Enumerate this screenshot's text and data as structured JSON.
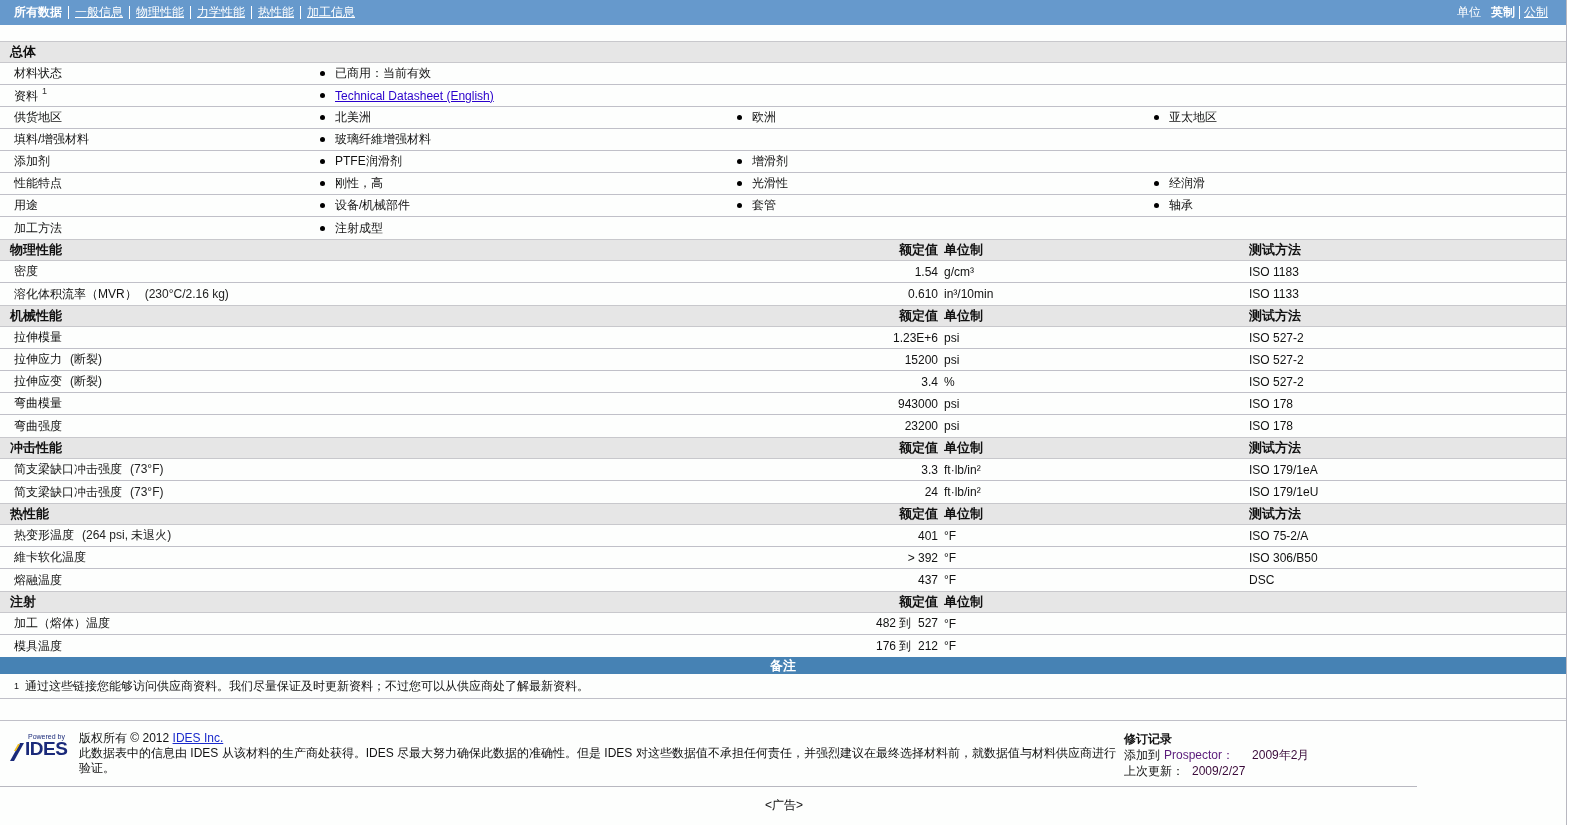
{
  "nav": {
    "tabs": [
      {
        "label": "所有数据",
        "selected": true
      },
      {
        "label": "一般信息",
        "selected": false
      },
      {
        "label": "物理性能",
        "selected": false
      },
      {
        "label": "力学性能",
        "selected": false
      },
      {
        "label": "热性能",
        "selected": false
      },
      {
        "label": "加工信息",
        "selected": false
      }
    ],
    "units": {
      "label": "单位",
      "options": [
        {
          "label": "英制",
          "selected": true
        },
        {
          "label": "公制",
          "selected": false
        }
      ]
    }
  },
  "general": {
    "title": "总体",
    "rows": [
      {
        "label": "材料状态",
        "items": [
          {
            "text": "已商用：当前有效",
            "kind": "text"
          }
        ]
      },
      {
        "label": "资料",
        "footnote": "1",
        "items": [
          {
            "text": "Technical Datasheet (English)",
            "kind": "link"
          }
        ]
      },
      {
        "label": "供货地区",
        "items": [
          {
            "text": "北美洲",
            "kind": "text"
          },
          {
            "text": "欧洲",
            "kind": "text"
          },
          {
            "text": "亚太地区",
            "kind": "text"
          }
        ]
      },
      {
        "label": "填料/增强材料",
        "items": [
          {
            "text": "玻璃纤維增强材料",
            "kind": "text"
          }
        ]
      },
      {
        "label": "添加剂",
        "items": [
          {
            "text": "PTFE润滑剂",
            "kind": "text"
          },
          {
            "text": "增滑剂",
            "kind": "text"
          }
        ]
      },
      {
        "label": "性能特点",
        "items": [
          {
            "text": "刚性，高",
            "kind": "text"
          },
          {
            "text": "光滑性",
            "kind": "text"
          },
          {
            "text": "经润滑",
            "kind": "text"
          }
        ]
      },
      {
        "label": "用途",
        "items": [
          {
            "text": "设备/机械部件",
            "kind": "text"
          },
          {
            "text": "套管",
            "kind": "text"
          },
          {
            "text": "轴承",
            "kind": "text"
          }
        ]
      },
      {
        "label": "加工方法",
        "items": [
          {
            "text": "注射成型",
            "kind": "text"
          }
        ]
      }
    ]
  },
  "sections": [
    {
      "title": "物理性能",
      "value_header": "额定值",
      "unit_header": "单位制",
      "method_header": "测试方法",
      "rows": [
        {
          "label": "密度",
          "value": "1.54",
          "unit": "g/cm³",
          "method": "ISO 1183"
        },
        {
          "label": "溶化体积流率（MVR）",
          "condition": "(230°C/2.16 kg)",
          "value": "0.610",
          "unit": "in³/10min",
          "method": "ISO 1133"
        }
      ]
    },
    {
      "title": "机械性能",
      "value_header": "额定值",
      "unit_header": "单位制",
      "method_header": "测试方法",
      "rows": [
        {
          "label": "拉伸模量",
          "value": "1.23E+6",
          "unit": "psi",
          "method": "ISO 527-2"
        },
        {
          "label": "拉伸应力",
          "condition": "(断裂)",
          "value": "15200",
          "unit": "psi",
          "method": "ISO 527-2"
        },
        {
          "label": "拉伸应变",
          "condition": "(断裂)",
          "value": "3.4",
          "unit": "%",
          "method": "ISO 527-2"
        },
        {
          "label": "弯曲模量",
          "value": "943000",
          "unit": "psi",
          "method": "ISO 178"
        },
        {
          "label": "弯曲强度",
          "value": "23200",
          "unit": "psi",
          "method": "ISO 178"
        }
      ]
    },
    {
      "title": "冲击性能",
      "value_header": "额定值",
      "unit_header": "单位制",
      "method_header": "测试方法",
      "rows": [
        {
          "label": "简支梁缺口冲击强度",
          "condition": "(73°F)",
          "value": "3.3",
          "unit": "ft·lb/in²",
          "method": "ISO 179/1eA"
        },
        {
          "label": "简支梁缺口冲击强度",
          "condition": "(73°F)",
          "value": "24",
          "unit": "ft·lb/in²",
          "method": "ISO 179/1eU"
        }
      ]
    },
    {
      "title": "热性能",
      "value_header": "额定值",
      "unit_header": "单位制",
      "method_header": "测试方法",
      "rows": [
        {
          "label": "热变形温度",
          "condition": "(264 psi, 未退火)",
          "value": "401",
          "unit": "°F",
          "method": "ISO 75-2/A"
        },
        {
          "label": "維卡软化温度",
          "value": "> 392",
          "unit": "°F",
          "method": "ISO 306/B50"
        },
        {
          "label": "熔融温度",
          "value": "437",
          "unit": "°F",
          "method": "DSC"
        }
      ]
    },
    {
      "title": "注射",
      "value_header": "额定值",
      "unit_header": "单位制",
      "rows": [
        {
          "label": "加工（熔体）温度",
          "value": "482 到  527",
          "unit": "°F"
        },
        {
          "label": "模具温度",
          "value": "176 到  212",
          "unit": "°F"
        }
      ]
    }
  ],
  "notes": {
    "title": "备注",
    "footnotes": [
      {
        "mark": "1",
        "text": "通过这些链接您能够访问供应商资料。我们尽量保证及时更新资料；不过您可以从供应商处了解最新资料。"
      }
    ]
  },
  "footer": {
    "logo": {
      "tagline": "Powered by",
      "name": "IDES"
    },
    "copyright": "版权所有",
    "year": "© 2012",
    "company_link": "IDES Inc.",
    "disclaimer": "此数据表中的信息由 IDES 从该材料的生产商处获得。IDES 尽最大努力确保此数据的准确性。但是 IDES 对这些数据值不承担任何责任，并强烈建议在最终选择材料前，就数据值与材料供应商进行验证。",
    "revision": {
      "title": "修订记录",
      "entries": [
        {
          "label": "添加到",
          "source": "Prospector：",
          "date": "2009年2月"
        },
        {
          "label": "上次更新：",
          "date": "2009/2/27"
        }
      ]
    }
  },
  "ad": "<广告>"
}
